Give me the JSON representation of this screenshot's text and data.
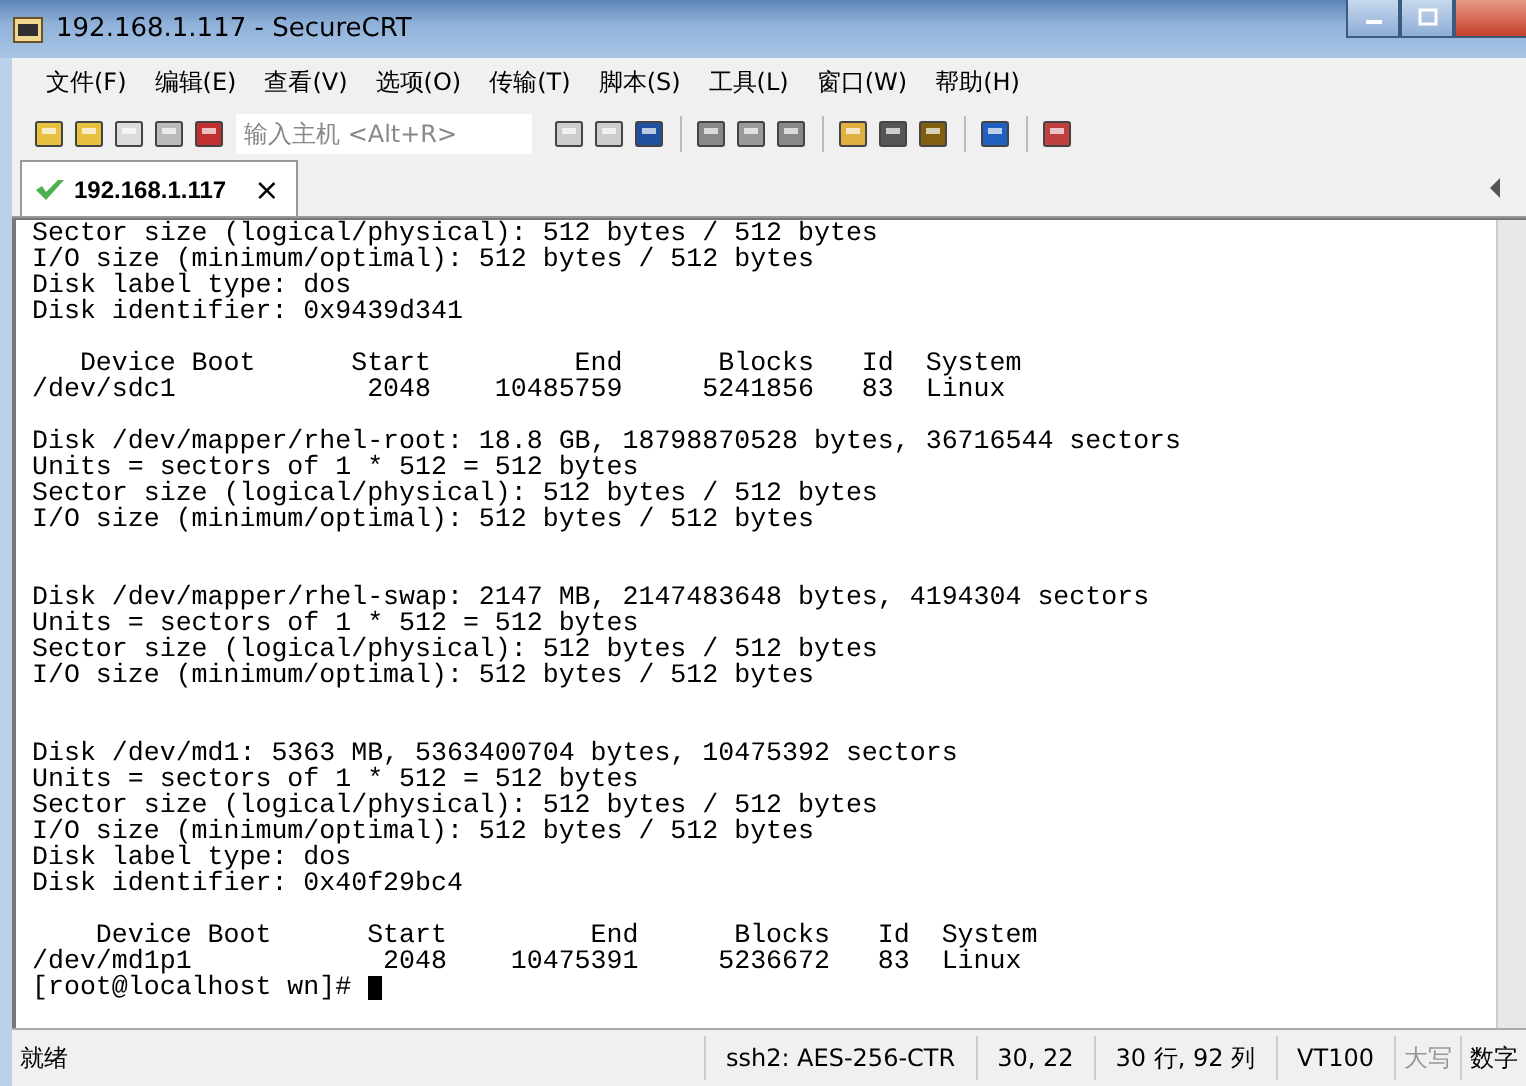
{
  "window": {
    "title": "192.168.1.117 - SecureCRT"
  },
  "menu": [
    "文件(F)",
    "编辑(E)",
    "查看(V)",
    "选项(O)",
    "传输(T)",
    "脚本(S)",
    "工具(L)",
    "窗口(W)",
    "帮助(H)"
  ],
  "toolbar": {
    "host_field": {
      "placeholder": "输入主机 <Alt+R>"
    }
  },
  "tabs": [
    {
      "label": "192.168.1.117",
      "selected": true,
      "connected": true,
      "close": "×"
    }
  ],
  "terminal": {
    "lines": [
      {
        "kind": "text",
        "text": "Sector size (logical/physical): 512 bytes / 512 bytes"
      },
      {
        "kind": "text",
        "text": "I/O size (minimum/optimal): 512 bytes / 512 bytes"
      },
      {
        "kind": "text",
        "text": "Disk label type: dos"
      },
      {
        "kind": "text",
        "text": "Disk identifier: 0x9439d341"
      },
      {
        "kind": "blank"
      },
      {
        "kind": "text",
        "text": "   Device Boot      Start         End      Blocks   Id  System"
      },
      {
        "kind": "text",
        "text": "/dev/sdc1            2048    10485759     5241856   83  Linux"
      },
      {
        "kind": "blank"
      },
      {
        "kind": "text",
        "text": "Disk /dev/mapper/rhel-root: 18.8 GB, 18798870528 bytes, 36716544 sectors"
      },
      {
        "kind": "text",
        "text": "Units = sectors of 1 * 512 = 512 bytes"
      },
      {
        "kind": "text",
        "text": "Sector size (logical/physical): 512 bytes / 512 bytes"
      },
      {
        "kind": "text",
        "text": "I/O size (minimum/optimal): 512 bytes / 512 bytes"
      },
      {
        "kind": "blank"
      },
      {
        "kind": "blank"
      },
      {
        "kind": "text",
        "text": "Disk /dev/mapper/rhel-swap: 2147 MB, 2147483648 bytes, 4194304 sectors"
      },
      {
        "kind": "text",
        "text": "Units = sectors of 1 * 512 = 512 bytes"
      },
      {
        "kind": "text",
        "text": "Sector size (logical/physical): 512 bytes / 512 bytes"
      },
      {
        "kind": "text",
        "text": "I/O size (minimum/optimal): 512 bytes / 512 bytes"
      },
      {
        "kind": "blank"
      },
      {
        "kind": "blank"
      },
      {
        "kind": "text",
        "text": "Disk /dev/md1: 5363 MB, 5363400704 bytes, 10475392 sectors"
      },
      {
        "kind": "text",
        "text": "Units = sectors of 1 * 512 = 512 bytes"
      },
      {
        "kind": "text",
        "text": "Sector size (logical/physical): 512 bytes / 512 bytes"
      },
      {
        "kind": "text",
        "text": "I/O size (minimum/optimal): 512 bytes / 512 bytes"
      },
      {
        "kind": "text",
        "text": "Disk label type: dos"
      },
      {
        "kind": "text",
        "text": "Disk identifier: 0x40f29bc4"
      },
      {
        "kind": "blank"
      },
      {
        "kind": "text",
        "text": "    Device Boot      Start         End      Blocks   Id  System"
      },
      {
        "kind": "text",
        "text": "/dev/md1p1            2048    10475391     5236672   83  Linux"
      },
      {
        "kind": "prompt",
        "text": "[root@localhost wn]# "
      }
    ]
  },
  "status_bar": [
    {
      "text": "就绪",
      "kind": "main"
    },
    {
      "text": "ssh2: AES-256-CTR",
      "kind": "cell"
    },
    {
      "text": "30,  22",
      "kind": "cell"
    },
    {
      "text": "30 行, 92 列",
      "kind": "cell"
    },
    {
      "text": "VT100",
      "kind": "cell"
    },
    {
      "text": "大写",
      "kind": "indicator",
      "on": false
    },
    {
      "text": "数字",
      "kind": "indicator",
      "on": true
    }
  ]
}
